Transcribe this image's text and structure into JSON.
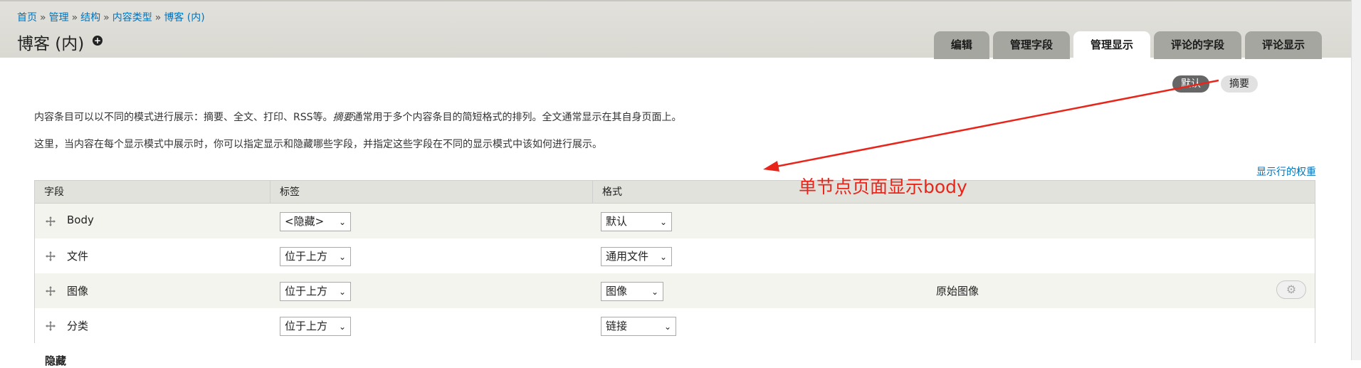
{
  "breadcrumb": [
    "首页",
    "管理",
    "结构",
    "内容类型",
    "博客 (内)"
  ],
  "page_title": "博客 (内)",
  "tabs": [
    "编辑",
    "管理字段",
    "管理显示",
    "评论的字段",
    "评论显示"
  ],
  "active_tab": "管理显示",
  "view_modes": [
    "默认",
    "摘要"
  ],
  "description": {
    "line1_a": "内容条目可以以不同的模式进行展示：摘要、全文、打印、RSS等。",
    "line1_em": "摘要",
    "line1_b": "通常用于多个内容条目的简短格式的排列。全文通常显示在其自身页面上。",
    "line2": "这里，当内容在每个显示模式中展示时，你可以指定显示和隐藏哪些字段，并指定这些字段在不同的显示模式中该如何进行展示。"
  },
  "weights_link": "显示行的权重",
  "annotation": "单节点页面显示body",
  "annotation_color": "#e8251b",
  "table": {
    "headers": [
      "字段",
      "标签",
      "格式"
    ],
    "rows": [
      {
        "field": "Body",
        "label": "<隐藏>",
        "format": "默认",
        "summary": ""
      },
      {
        "field": "文件",
        "label": "位于上方",
        "format": "通用文件",
        "summary": ""
      },
      {
        "field": "图像",
        "label": "位于上方",
        "format": "图像",
        "summary": "原始图像"
      },
      {
        "field": "分类",
        "label": "位于上方",
        "format": "链接",
        "summary": ""
      }
    ],
    "hidden_section": "隐藏"
  }
}
